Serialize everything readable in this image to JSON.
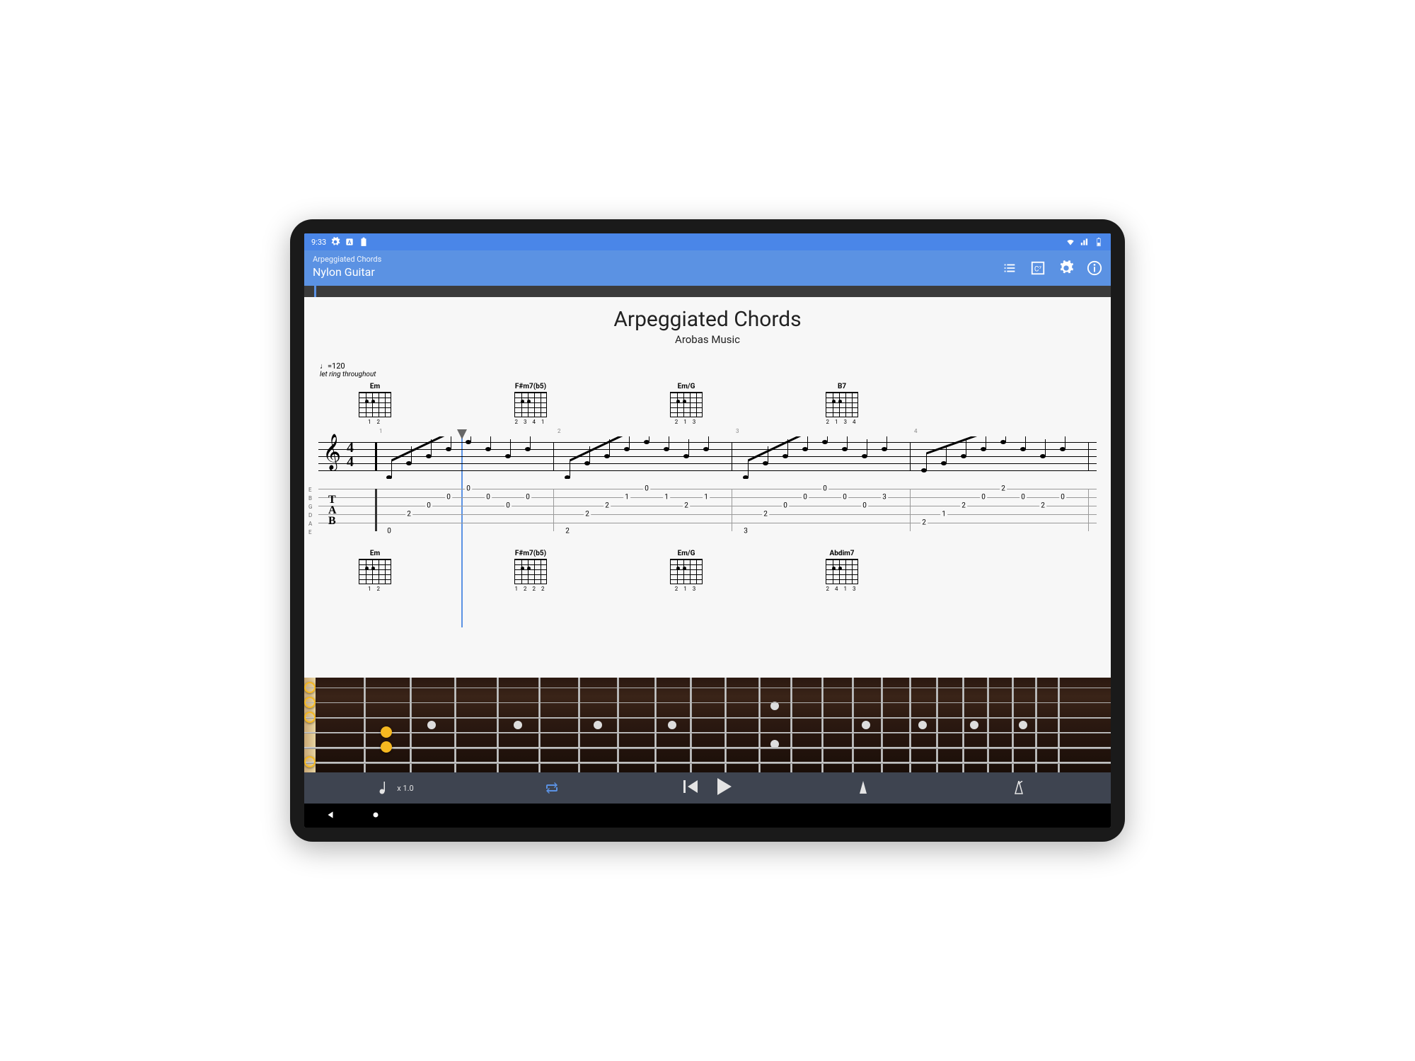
{
  "statusbar": {
    "time": "9:33"
  },
  "header": {
    "subtitle": "Arpeggiated Chords",
    "title": "Nylon Guitar"
  },
  "score": {
    "title": "Arpeggiated Chords",
    "artist": "Arobas Music",
    "tempo": "♩=120",
    "direction": "let ring throughout",
    "time_sig_top": "4",
    "time_sig_bot": "4",
    "chords_row1": [
      {
        "name": "Em",
        "fingers": "1 2"
      },
      {
        "name": "F#m7(b5)",
        "fingers": "2  3 4 1"
      },
      {
        "name": "Em/G",
        "fingers": "2  1   3"
      },
      {
        "name": "B7",
        "fingers": "2 1 3   4"
      }
    ],
    "chords_row2": [
      {
        "name": "Em",
        "fingers": "1 2"
      },
      {
        "name": "F#m7(b5)",
        "fingers": "1 2 2 2"
      },
      {
        "name": "Em/G",
        "fingers": "2  1   3"
      },
      {
        "name": "Abdim7",
        "fingers": "2 4 1 3"
      }
    ],
    "tab_measures": [
      [
        {
          "s": 6,
          "f": 0,
          "x": 0
        },
        {
          "s": 4,
          "f": 2,
          "x": 1
        },
        {
          "s": 3,
          "f": 0,
          "x": 2
        },
        {
          "s": 2,
          "f": 0,
          "x": 3
        },
        {
          "s": 1,
          "f": 0,
          "x": 4
        },
        {
          "s": 2,
          "f": 0,
          "x": 5
        },
        {
          "s": 3,
          "f": 0,
          "x": 6
        },
        {
          "s": 2,
          "f": 0,
          "x": 7
        }
      ],
      [
        {
          "s": 6,
          "f": 2,
          "x": 0
        },
        {
          "s": 4,
          "f": 2,
          "x": 1
        },
        {
          "s": 3,
          "f": 2,
          "x": 2
        },
        {
          "s": 2,
          "f": 1,
          "x": 3
        },
        {
          "s": 1,
          "f": 0,
          "x": 4
        },
        {
          "s": 2,
          "f": 1,
          "x": 5
        },
        {
          "s": 3,
          "f": 2,
          "x": 6
        },
        {
          "s": 2,
          "f": 1,
          "x": 7
        }
      ],
      [
        {
          "s": 6,
          "f": 3,
          "x": 0
        },
        {
          "s": 4,
          "f": 2,
          "x": 1
        },
        {
          "s": 3,
          "f": 0,
          "x": 2
        },
        {
          "s": 2,
          "f": 0,
          "x": 3
        },
        {
          "s": 1,
          "f": 0,
          "x": 4
        },
        {
          "s": 2,
          "f": 0,
          "x": 5
        },
        {
          "s": 3,
          "f": 0,
          "x": 6
        },
        {
          "s": 2,
          "f": 3,
          "x": 7
        }
      ],
      [
        {
          "s": 5,
          "f": 2,
          "x": 0
        },
        {
          "s": 4,
          "f": 1,
          "x": 1
        },
        {
          "s": 3,
          "f": 2,
          "x": 2
        },
        {
          "s": 2,
          "f": 0,
          "x": 3
        },
        {
          "s": 1,
          "f": 2,
          "x": 4
        },
        {
          "s": 2,
          "f": 0,
          "x": 5
        },
        {
          "s": 3,
          "f": 2,
          "x": 6
        },
        {
          "s": 2,
          "f": 0,
          "x": 7
        }
      ]
    ],
    "string_labels": [
      "E",
      "B",
      "G",
      "D",
      "A",
      "E"
    ]
  },
  "playbar": {
    "speed": "x 1.0"
  }
}
